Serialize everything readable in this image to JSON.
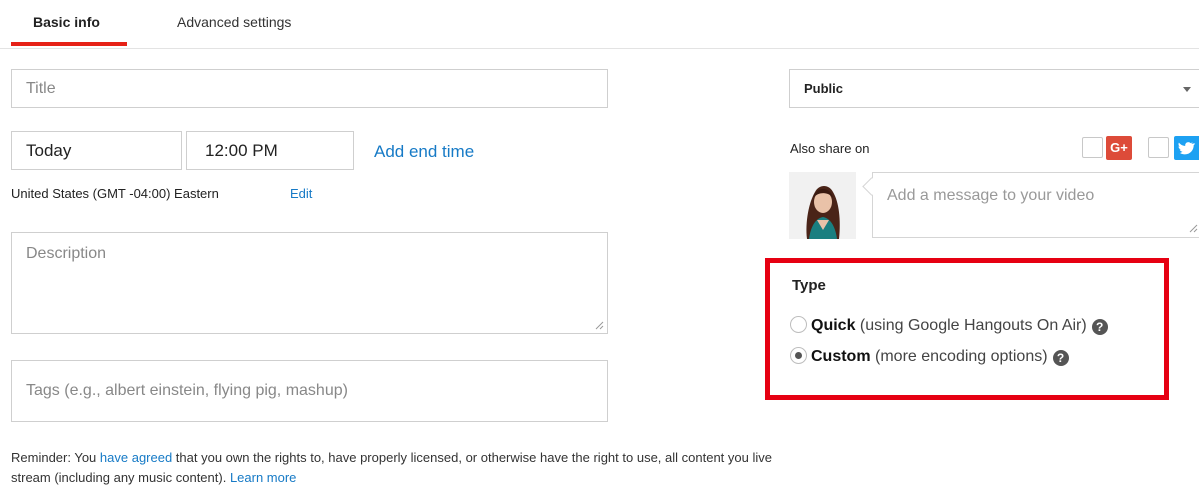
{
  "tabs": [
    {
      "label": "Basic info",
      "active": true
    },
    {
      "label": "Advanced settings",
      "active": false
    }
  ],
  "form": {
    "title_placeholder": "Title",
    "date_value": "Today",
    "time_value": "12:00 PM",
    "add_end_time_link": "Add end time",
    "timezone_text": "United States (GMT -04:00) Eastern",
    "timezone_edit_link": "Edit",
    "description_placeholder": "Description",
    "tags_placeholder": "Tags (e.g., albert einstein, flying pig, mashup)"
  },
  "reminder": {
    "prefix": "Reminder: You ",
    "link_agreed": "have agreed",
    "middle": " that you own the rights to, have properly licensed, or otherwise have the right to use, all content you live stream (including any music content). ",
    "link_learn_more": "Learn more"
  },
  "privacy": {
    "selected": "Public"
  },
  "share": {
    "label": "Also share on",
    "google_plus_label": "G+",
    "message_placeholder": "Add a message to your video"
  },
  "type_section": {
    "title": "Type",
    "options": [
      {
        "name": "Quick",
        "description": "(using Google Hangouts On Air)",
        "selected": false
      },
      {
        "name": "Custom",
        "description": "(more encoding options)",
        "selected": true
      }
    ],
    "help_glyph": "?"
  },
  "colors": {
    "accent_red": "#e62117",
    "highlight_box": "#e60012",
    "link_blue": "#167ac6",
    "google_plus": "#dd4b39",
    "twitter": "#1da1f2"
  },
  "icons": [
    "google-plus-icon",
    "twitter-icon",
    "help-icon",
    "dropdown-caret-icon",
    "resize-grip-icon"
  ]
}
